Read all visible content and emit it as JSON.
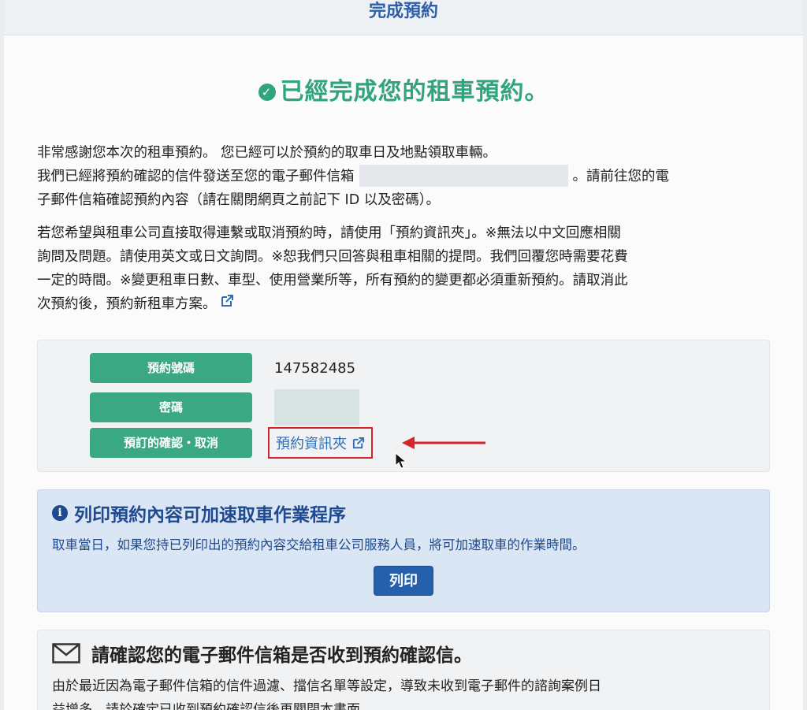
{
  "header": {
    "title": "完成預約"
  },
  "hero": {
    "title": "已經完成您的租車預約。",
    "icon": "check-circle-icon"
  },
  "intro": {
    "line1": "非常感謝您本次的租車預約。 您已經可以於預約的取車日及地點領取車輛。",
    "line2_prefix": "我們已經將預約確認的信件發送至您的電子郵件信箱",
    "line2_suffix": "。請前往您的電",
    "line3": "子郵件信箱確認預約內容（請在關閉網頁之前記下 ID 以及密碼）。"
  },
  "contact": {
    "line1": "若您希望與租車公司直接取得連繫或取消預約時，請使用「預約資訊夾」。※無法以中文回應相關",
    "line2": "詢問及問題。請使用英文或日文詢問。※恕我們只回答與租車相關的提問。我們回覆您時需要花費",
    "line3": "一定的時間。※變更租車日數、車型、使用營業所等，所有預約的變更都必須重新預約。請取消此",
    "line4": "次預約後，預約新租車方案。",
    "icon": "external-link-icon"
  },
  "booking": {
    "number_label": "預約號碼",
    "number_value": "147582485",
    "password_label": "密碼",
    "manage_label": "預訂的確認・取消",
    "manage_link": "預約資訊夾"
  },
  "print": {
    "title": "列印預約內容可加速取車作業程序",
    "desc": "取車當日，如果您持已列印出的預約內容交給租車公司服務人員，將可加速取車的作業時間。",
    "button": "列印"
  },
  "mail": {
    "title": "請確認您的電子郵件信箱是否收到預約確認信。",
    "line1": "由於最近因為電子郵件信箱的信件過濾、擋信名單等設定，導致未收到電子郵件的諮詢案例日",
    "line2": "益增多，請於確定已收到預約確認信後再關閉本書面。"
  },
  "colors": {
    "brand_green": "#3aa883",
    "heading_green": "#30a57b",
    "link_blue": "#2f6db7",
    "alert_red": "#d6242c",
    "print_blue": "#2560ad"
  }
}
